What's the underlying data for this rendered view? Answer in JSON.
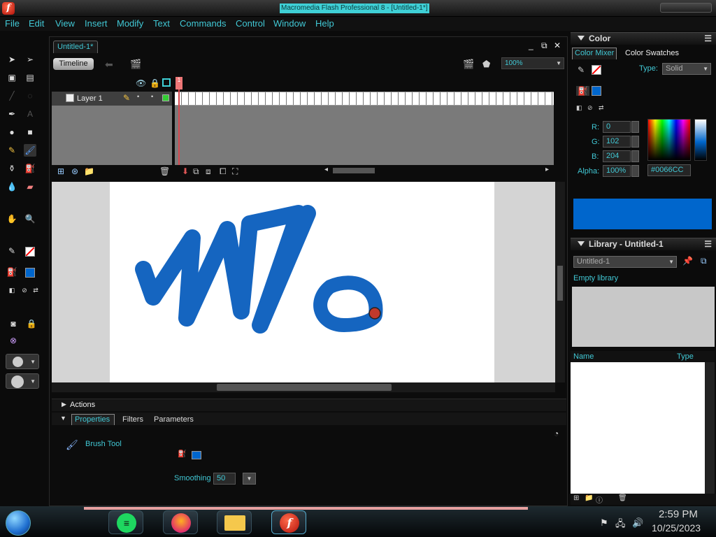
{
  "window": {
    "title": "Macromedia Flash Professional 8 - [Untitled-1*]"
  },
  "menu": [
    "File",
    "Edit",
    "View",
    "Insert",
    "Modify",
    "Text",
    "Commands",
    "Control",
    "Window",
    "Help"
  ],
  "document": {
    "tab": "Untitled-1*",
    "timeline_button": "Timeline",
    "zoom": "100%",
    "layer_name": "Layer 1",
    "current_frame": "1"
  },
  "panels": {
    "actions": "Actions",
    "properties_tabs": [
      "Properties",
      "Filters",
      "Parameters"
    ],
    "tool_name": "Brush Tool",
    "smoothing_label": "Smoothing",
    "smoothing_value": "50"
  },
  "color": {
    "title": "Color",
    "tabs": [
      "Color Mixer",
      "Color Swatches"
    ],
    "type_label": "Type:",
    "type_value": "Solid",
    "r_label": "R:",
    "r": "0",
    "g_label": "G:",
    "g": "102",
    "b_label": "B:",
    "b": "204",
    "alpha_label": "Alpha:",
    "alpha": "100%",
    "hex": "#0066CC",
    "swatch_color": "#0066cc"
  },
  "library": {
    "title": "Library - Untitled-1",
    "selector": "Untitled-1",
    "empty_text": "Empty library",
    "col_name": "Name",
    "col_type": "Type"
  },
  "tray": {
    "time": "2:59 PM",
    "date": "10/25/2023"
  },
  "colors": {
    "accent": "#41c8d5",
    "brush": "#1565c0",
    "stage": "#ffffff"
  }
}
